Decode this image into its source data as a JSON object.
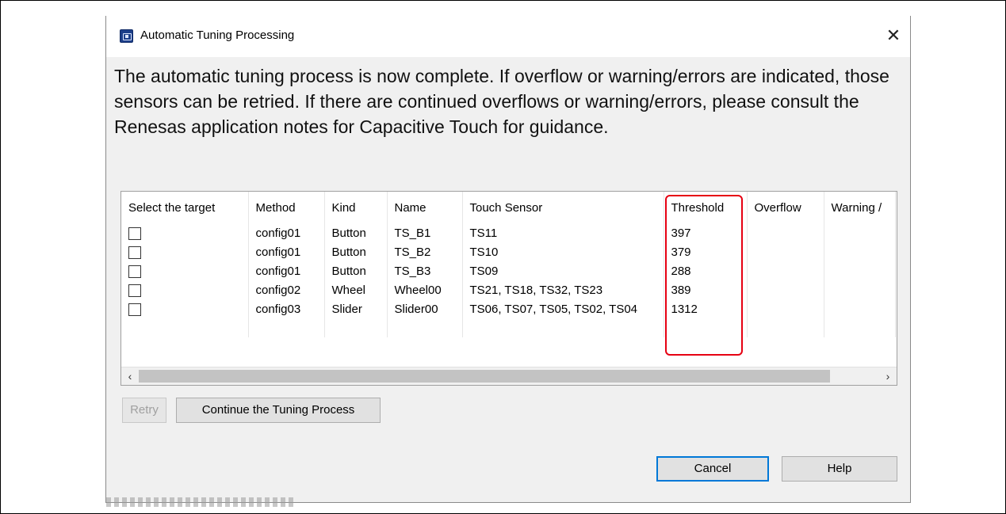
{
  "window": {
    "title": "Automatic Tuning Processing",
    "close_glyph": "✕",
    "app_icon": "renesas-app-icon"
  },
  "description": "The automatic tuning process is now complete. If overflow or warning/errors are indicated, those sensors can be retried. If there are continued overflows or warning/errors, please consult the Renesas application notes for Capacitive Touch for guidance.",
  "table": {
    "columns": [
      "Select the target",
      "Method",
      "Kind",
      "Name",
      "Touch Sensor",
      "Threshold",
      "Overflow",
      "Warning /"
    ],
    "rows": [
      {
        "selected": false,
        "method": "config01",
        "kind": "Button",
        "name": "TS_B1",
        "touch_sensor": "TS11",
        "threshold": "397",
        "overflow": "",
        "warning": ""
      },
      {
        "selected": false,
        "method": "config01",
        "kind": "Button",
        "name": "TS_B2",
        "touch_sensor": "TS10",
        "threshold": "379",
        "overflow": "",
        "warning": ""
      },
      {
        "selected": false,
        "method": "config01",
        "kind": "Button",
        "name": "TS_B3",
        "touch_sensor": "TS09",
        "threshold": "288",
        "overflow": "",
        "warning": ""
      },
      {
        "selected": false,
        "method": "config02",
        "kind": "Wheel",
        "name": "Wheel00",
        "touch_sensor": "TS21, TS18, TS32, TS23",
        "threshold": "389",
        "overflow": "",
        "warning": ""
      },
      {
        "selected": false,
        "method": "config03",
        "kind": "Slider",
        "name": "Slider00",
        "touch_sensor": "TS06, TS07, TS05, TS02, TS04",
        "threshold": "1312",
        "overflow": "",
        "warning": ""
      }
    ],
    "highlight_color": "#e60012",
    "scroll_left_glyph": "‹",
    "scroll_right_glyph": "›"
  },
  "buttons": {
    "retry": "Retry",
    "continue": "Continue the Tuning Process",
    "cancel": "Cancel",
    "help": "Help"
  }
}
